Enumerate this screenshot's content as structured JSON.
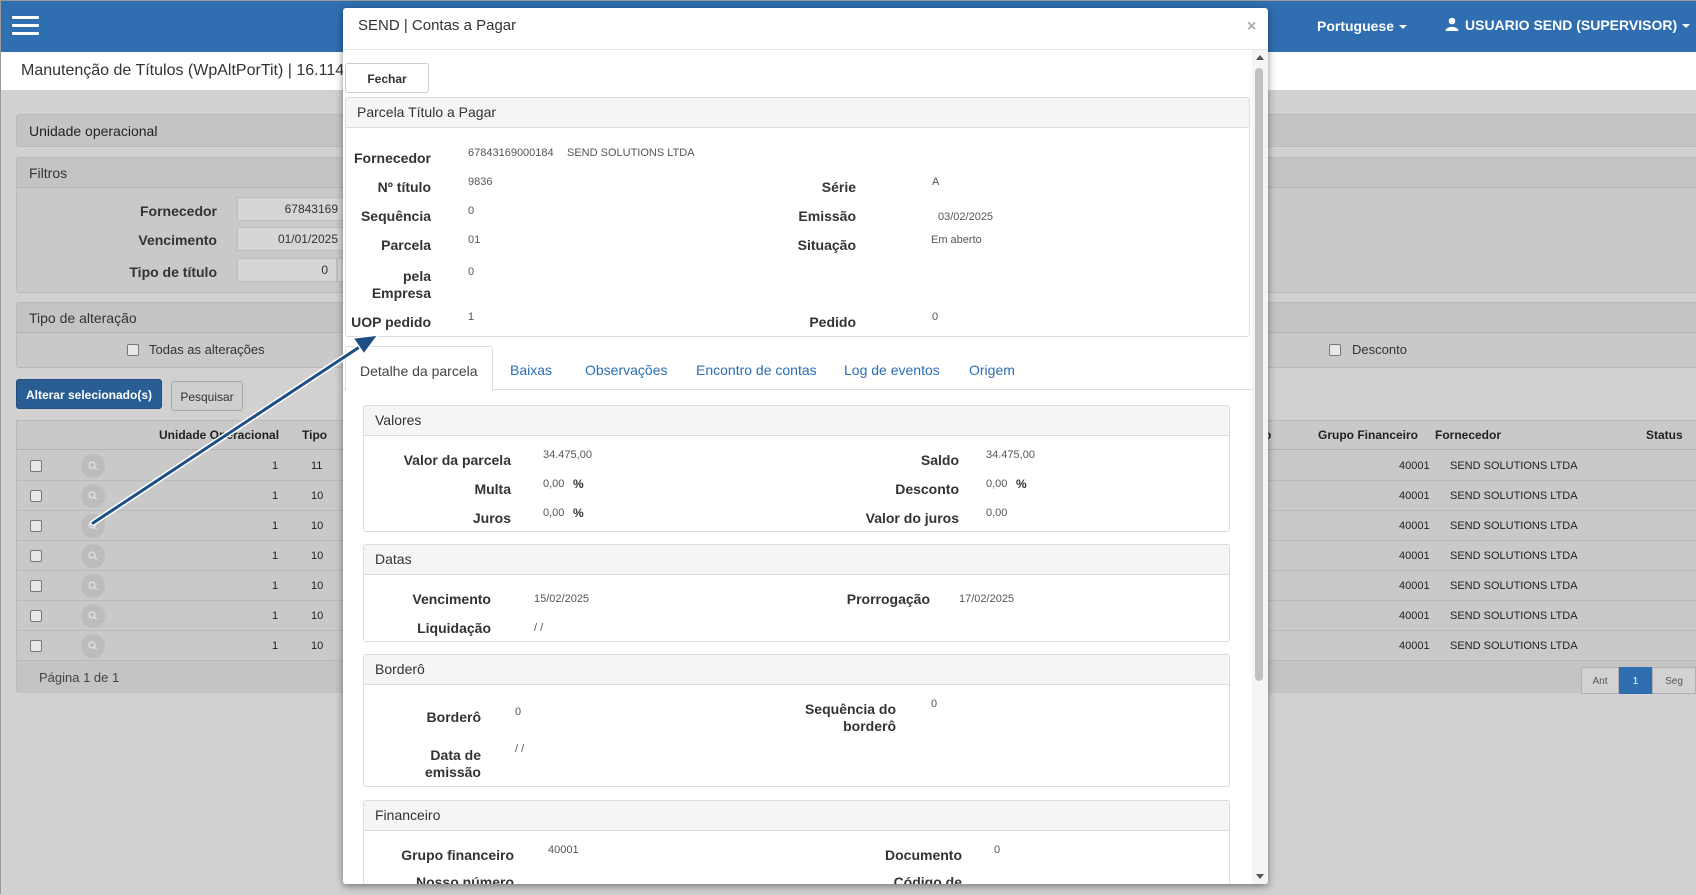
{
  "header": {
    "language": "Portuguese",
    "user": "USUARIO SEND (SUPERVISOR)"
  },
  "page": {
    "title": "Manutenção de Títulos (WpAltPorTit) | 16.114"
  },
  "unit_panel": {
    "title": "Unidade operacional"
  },
  "filters": {
    "title": "Filtros",
    "fornecedor_label": "Fornecedor",
    "fornecedor_value": "67843169",
    "vencimento_label": "Vencimento",
    "vencimento_value": "01/01/2025",
    "tipo_label": "Tipo de título",
    "tipo_value": "0"
  },
  "alteration": {
    "title": "Tipo de alteração",
    "all_label": "Todas as alterações",
    "desconto_label": "Desconto"
  },
  "actions": {
    "alter_button": "Alterar selecionado(s)",
    "search_button": "Pesquisar"
  },
  "grid": {
    "headers": {
      "unidade": "Unidade Operacional",
      "tipo": "Tipo",
      "partial": "o",
      "grupo": "Grupo Financeiro",
      "fornecedor": "Fornecedor",
      "status": "Status"
    },
    "rows": [
      {
        "unidade": "1",
        "tipo": "11",
        "grupo": "40001",
        "fornecedor": "SEND SOLUTIONS LTDA"
      },
      {
        "unidade": "1",
        "tipo": "10",
        "grupo": "40001",
        "fornecedor": "SEND SOLUTIONS LTDA"
      },
      {
        "unidade": "1",
        "tipo": "10",
        "grupo": "40001",
        "fornecedor": "SEND SOLUTIONS LTDA"
      },
      {
        "unidade": "1",
        "tipo": "10",
        "grupo": "40001",
        "fornecedor": "SEND SOLUTIONS LTDA"
      },
      {
        "unidade": "1",
        "tipo": "10",
        "grupo": "40001",
        "fornecedor": "SEND SOLUTIONS LTDA"
      },
      {
        "unidade": "1",
        "tipo": "10",
        "grupo": "40001",
        "fornecedor": "SEND SOLUTIONS LTDA"
      },
      {
        "unidade": "1",
        "tipo": "10",
        "grupo": "40001",
        "fornecedor": "SEND SOLUTIONS LTDA"
      }
    ],
    "page_info": "Página 1 de 1",
    "pager": {
      "prev": "Ant",
      "current": "1",
      "next": "Seg"
    }
  },
  "modal": {
    "title": "SEND | Contas a Pagar",
    "close_symbol": "×",
    "fechar": "Fechar",
    "parcela": {
      "title": "Parcela Título a Pagar",
      "fornecedor_label": "Fornecedor",
      "fornecedor_code": "67843169000184",
      "fornecedor_name": "SEND SOLUTIONS LTDA",
      "titulo_label": "Nº título",
      "titulo_value": "9836",
      "serie_label": "Série",
      "serie_value": "A",
      "sequencia_label": "Sequência",
      "sequencia_value": "0",
      "emissao_label": "Emissão",
      "emissao_value": "03/02/2025",
      "parcela_label": "Parcela",
      "parcela_value": "01",
      "situacao_label": "Situação",
      "situacao_value": "Em aberto",
      "pela_empresa_label_1": "pela",
      "pela_empresa_label_2": "Empresa",
      "pela_empresa_value": "0",
      "uop_label": "UOP pedido",
      "uop_value": "1",
      "pedido_label": "Pedido",
      "pedido_value": "0"
    },
    "tabs": [
      {
        "label": "Detalhe da parcela"
      },
      {
        "label": "Baixas"
      },
      {
        "label": "Observações"
      },
      {
        "label": "Encontro de contas"
      },
      {
        "label": "Log de eventos"
      },
      {
        "label": "Origem"
      }
    ],
    "valores": {
      "title": "Valores",
      "valor_label": "Valor da parcela",
      "valor_value": "34.475,00",
      "saldo_label": "Saldo",
      "saldo_value": "34.475,00",
      "multa_label": "Multa",
      "multa_value": "0,00",
      "desconto_label": "Desconto",
      "desconto_value": "0,00",
      "juros_label": "Juros",
      "juros_value": "0,00",
      "valor_juros_label": "Valor do juros",
      "valor_juros_value": "0,00",
      "percent": "%"
    },
    "datas": {
      "title": "Datas",
      "vencimento_label": "Vencimento",
      "vencimento_value": "15/02/2025",
      "prorrogacao_label": "Prorrogação",
      "prorrogacao_value": "17/02/2025",
      "liquidacao_label": "Liquidação",
      "liquidacao_value": "/ /"
    },
    "bordero": {
      "title": "Borderô",
      "bordero_label": "Borderô",
      "bordero_value": "0",
      "seq_label_1": "Sequência do",
      "seq_label_2": "borderô",
      "seq_value": "0",
      "data_label_1": "Data de",
      "data_label_2": "emissão",
      "data_value": "/ /"
    },
    "financeiro": {
      "title": "Financeiro",
      "grupo_label": "Grupo financeiro",
      "grupo_value": "40001",
      "documento_label": "Documento",
      "documento_value": "0",
      "nosso_label": "Nosso número",
      "codigo_label": "Código de"
    }
  },
  "colors": {
    "topbar": "#2f6eb0",
    "primary_button": "#285e94",
    "tab_link": "#2a6fb5",
    "arrow": "#1b4f86"
  }
}
